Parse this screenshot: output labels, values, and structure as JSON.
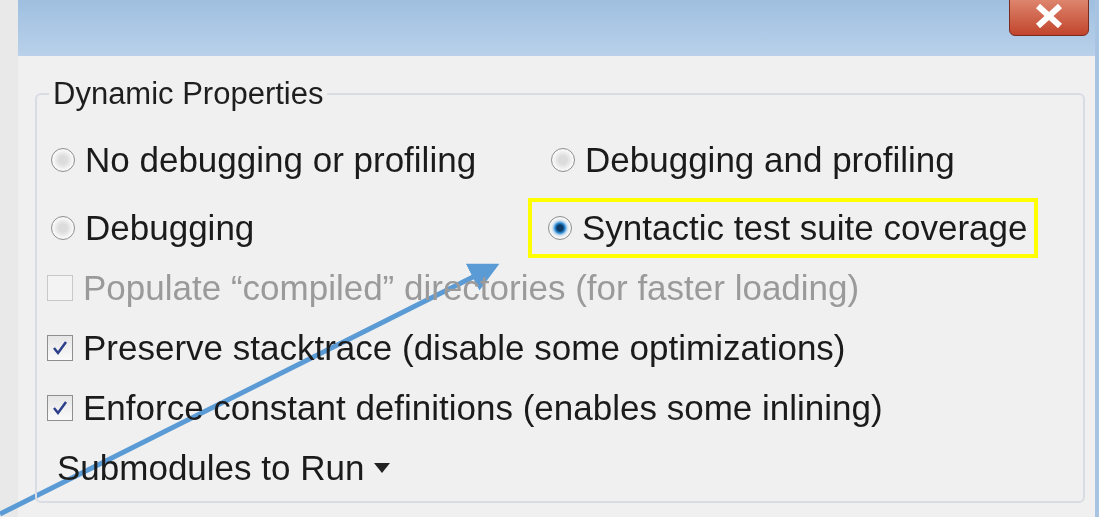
{
  "group": {
    "title": "Dynamic Properties"
  },
  "modes": [
    {
      "label": "No debugging or profiling",
      "selected": false,
      "highlighted": false
    },
    {
      "label": "Debugging and profiling",
      "selected": false,
      "highlighted": false
    },
    {
      "label": "Debugging",
      "selected": false,
      "highlighted": false
    },
    {
      "label": "Syntactic test suite coverage",
      "selected": true,
      "highlighted": true
    }
  ],
  "options": [
    {
      "label": "Populate “compiled” directories (for faster loading)",
      "checked": false,
      "disabled": true
    },
    {
      "label": "Preserve stacktrace (disable some optimizations)",
      "checked": true,
      "disabled": false
    },
    {
      "label": "Enforce constant definitions (enables some inlining)",
      "checked": true,
      "disabled": false
    }
  ],
  "submodules": {
    "label": "Submodules to Run"
  }
}
